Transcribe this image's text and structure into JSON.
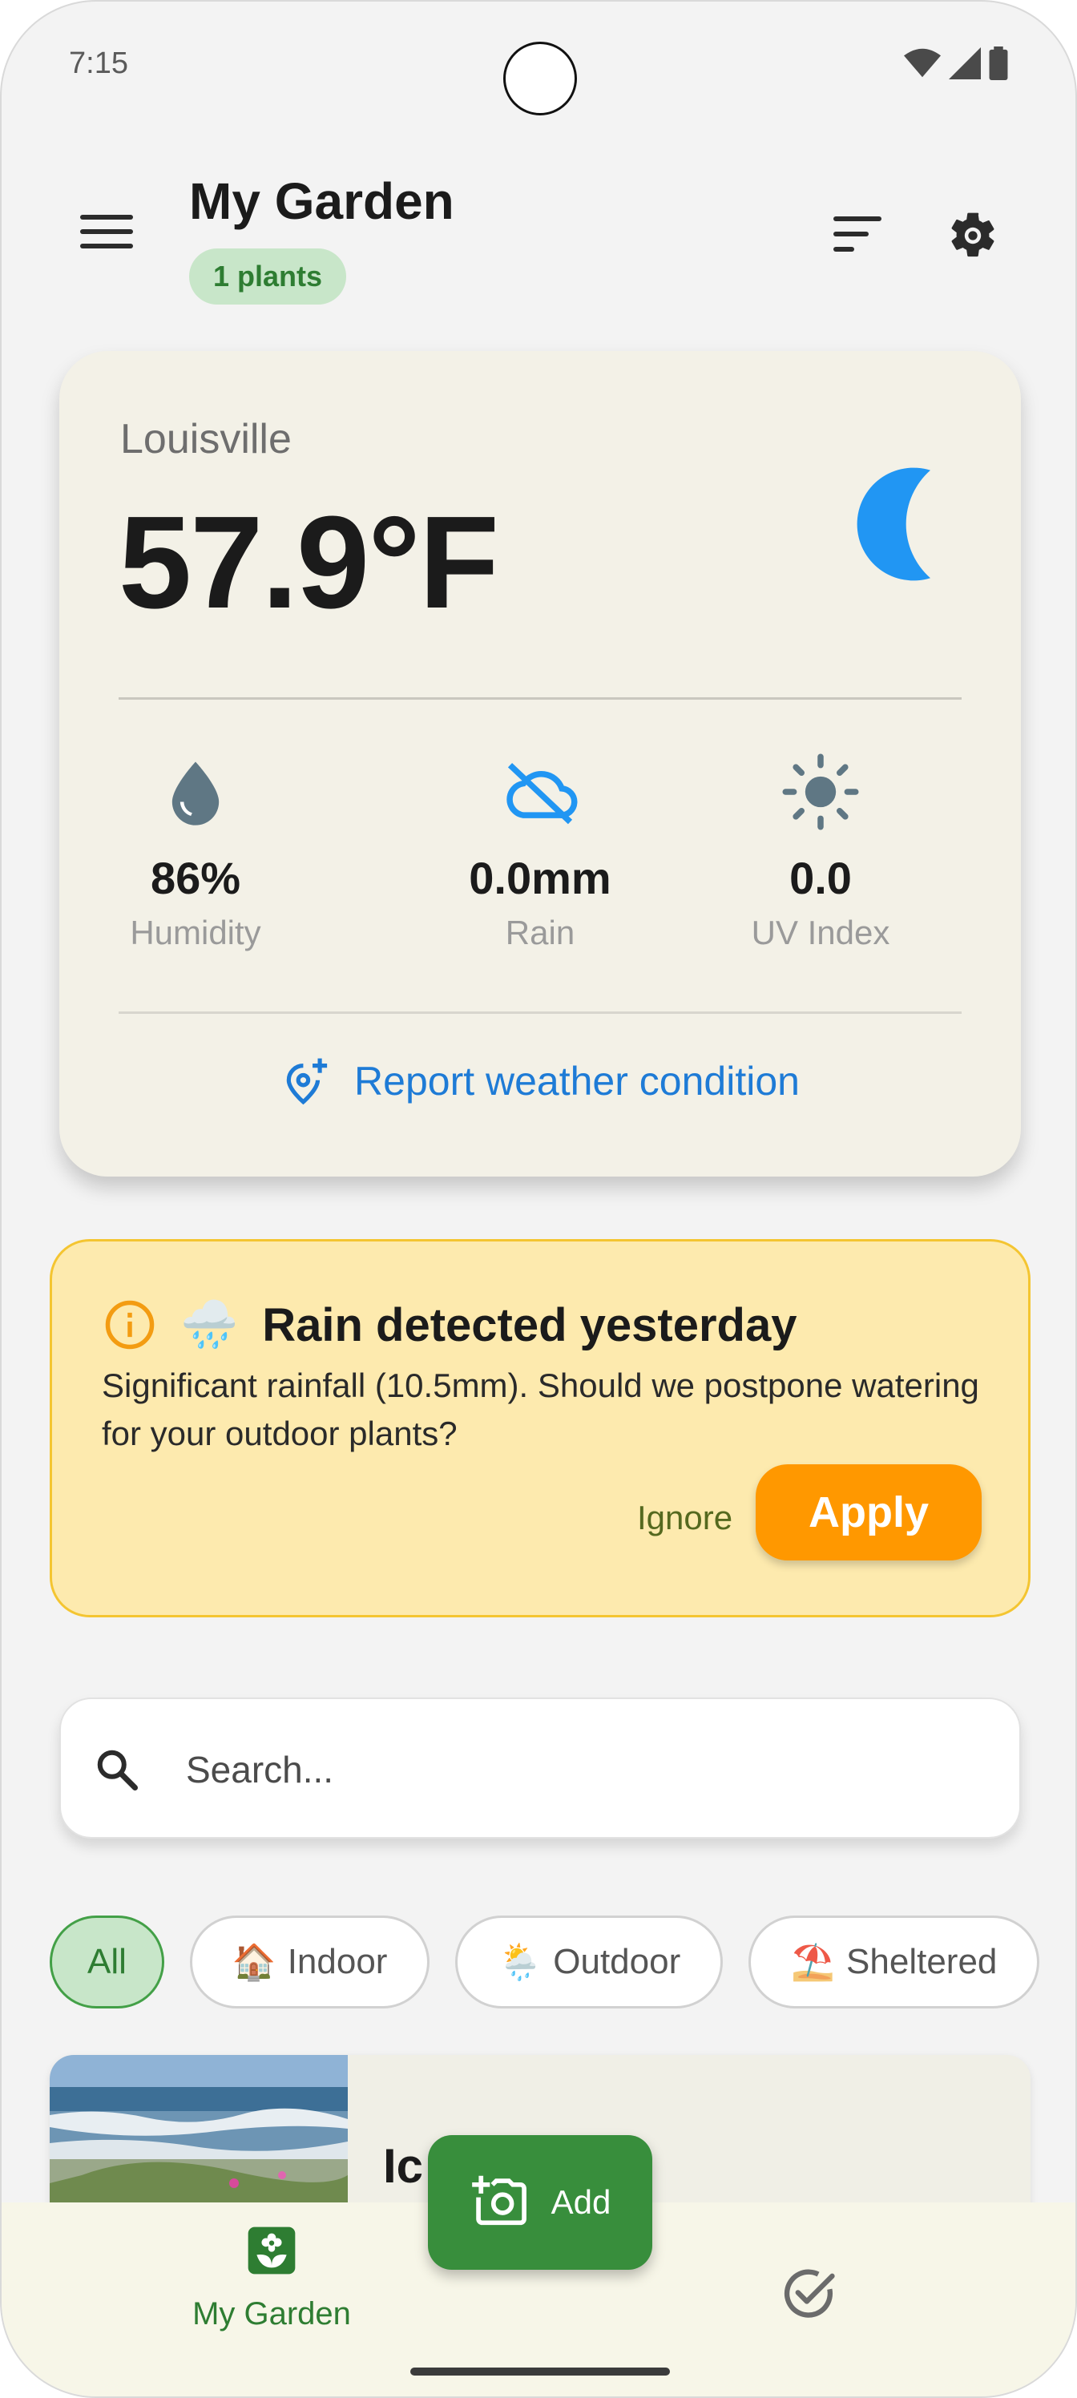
{
  "status_bar": {
    "time": "7:15"
  },
  "header": {
    "title": "My Garden",
    "plant_count_badge": "1 plants"
  },
  "weather": {
    "city": "Louisville",
    "temperature": "57.9°F",
    "condition_icon": "moon-icon",
    "metrics": [
      {
        "icon": "water-drop-icon",
        "value": "86%",
        "label": "Humidity"
      },
      {
        "icon": "cloud-off-icon",
        "value": "0.0mm",
        "label": "Rain"
      },
      {
        "icon": "sun-icon",
        "value": "0.0",
        "label": "UV Index"
      }
    ],
    "report_link": "Report weather condition"
  },
  "alert": {
    "emoji": "🌧️",
    "title": "Rain detected yesterday",
    "body": "Significant rainfall (10.5mm). Should we postpone watering for your outdoor plants?",
    "ignore_label": "Ignore",
    "apply_label": "Apply"
  },
  "search": {
    "placeholder": "Search..."
  },
  "filters": [
    {
      "emoji": "",
      "label": "All",
      "active": true
    },
    {
      "emoji": "🏠",
      "label": "Indoor",
      "active": false
    },
    {
      "emoji": "🌦️",
      "label": "Outdoor",
      "active": false
    },
    {
      "emoji": "⛱️",
      "label": "Sheltered",
      "active": false
    }
  ],
  "plants": [
    {
      "name_visible": "Ic"
    }
  ],
  "fab": {
    "label": "Add"
  },
  "bottom_nav": {
    "garden_label": "My Garden"
  },
  "colors": {
    "primary_green": "#388e3c",
    "accent_blue": "#1e7bd6",
    "warning_orange": "#ff9800",
    "alert_background": "#fdeaae"
  }
}
